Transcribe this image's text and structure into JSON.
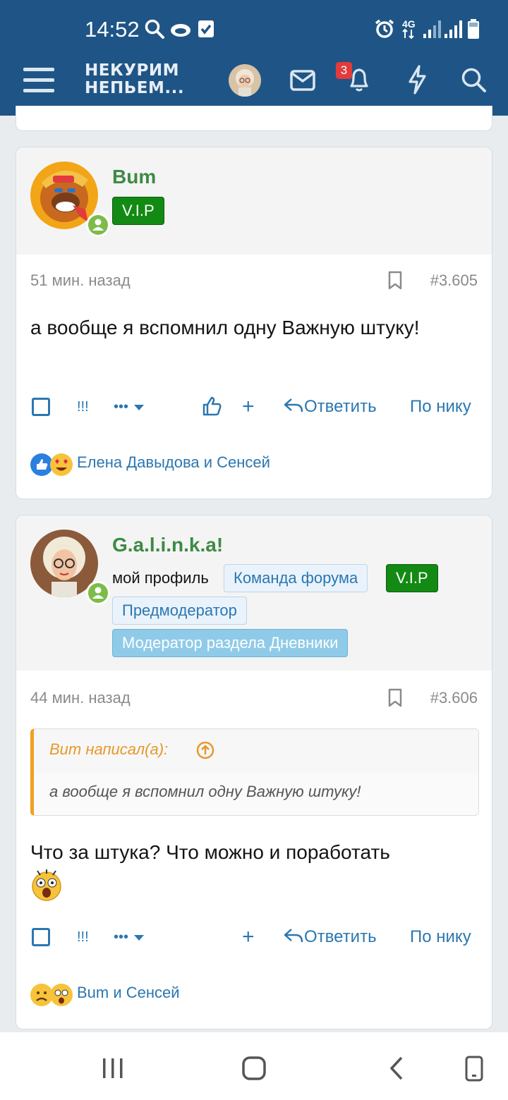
{
  "status_bar": {
    "time": "14:52",
    "network": "4G",
    "icons": [
      "search-icon",
      "cloud-icon",
      "check-icon",
      "alarm-icon",
      "signal-icon",
      "battery-icon"
    ]
  },
  "header": {
    "logo_line1": "НЕКУРИМ",
    "logo_line2": "НЕПЬЕМ...",
    "notifications_count": "3",
    "icons": [
      "menu-icon",
      "mail-icon",
      "bell-icon",
      "lightning-icon",
      "search-icon"
    ],
    "bg_color": "#1f5586"
  },
  "posts": [
    {
      "username": "Bum",
      "badges": [
        "V.I.P"
      ],
      "time_ago": "51 мин. назад",
      "post_number": "#3.605",
      "text": "а вообще я вспомнил одну Важную штуку!",
      "actions": {
        "mark": "!!!",
        "more": "•••",
        "reply": "Ответить",
        "by_nick": "По нику"
      },
      "reactions_text": "Елена Давыдова и Сенсей"
    },
    {
      "username": "G.a.l.i.n.k.a!",
      "profile_link": "мой профиль",
      "badges": [
        "Команда форума",
        "V.I.P",
        "Предмодератор",
        "Модератор раздела Дневники"
      ],
      "time_ago": "44 мин. назад",
      "post_number": "#3.606",
      "quote_author": "Bum написал(а):",
      "quote_text": "а вообще я вспомнил одну Важную штуку!",
      "text": "Что за штука? Что можно и поработать",
      "actions": {
        "mark": "!!!",
        "more": "•••",
        "reply": "Ответить",
        "by_nick": "По нику"
      },
      "reactions_text": "Bum и Сенсей"
    }
  ],
  "colors": {
    "link": "#2b77b0",
    "username": "#3d8a44",
    "vip_badge": "#138a13",
    "quote_accent": "#f0a020",
    "online": "#7cbc48"
  }
}
